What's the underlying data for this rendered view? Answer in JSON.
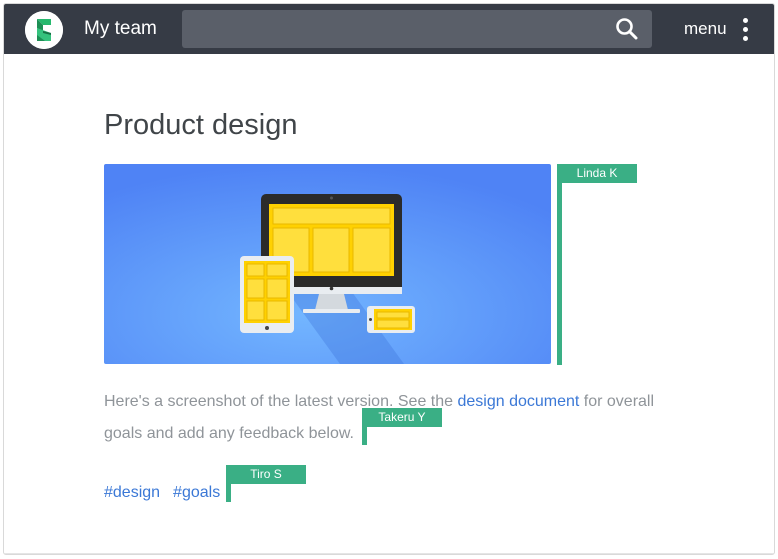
{
  "header": {
    "team_title": "My team",
    "search_placeholder": "",
    "search_icon": "search-icon",
    "menu_label": "menu",
    "menu_icon": "kebab-menu-icon",
    "logo_icon": "app-logo-icon",
    "colors": {
      "bar": "#363b45",
      "search_bg": "#5a5f69"
    }
  },
  "post": {
    "title": "Product design",
    "image_alt": "Illustration of a desktop monitor, tablet and phone",
    "body_before": "Here's a screenshot of the latest version. See the ",
    "link_text": "design document",
    "body_after": " for overall goals and add any feedback below.",
    "tags": [
      "#design",
      "#goals"
    ]
  },
  "collaborators": [
    {
      "name": "Linda K"
    },
    {
      "name": "Takeru Y"
    },
    {
      "name": "Tiro S"
    }
  ],
  "colors": {
    "accent_link": "#3b78d6",
    "collaborator_flag": "#3aaf85",
    "text_muted": "#8f9499",
    "title": "#404549"
  }
}
